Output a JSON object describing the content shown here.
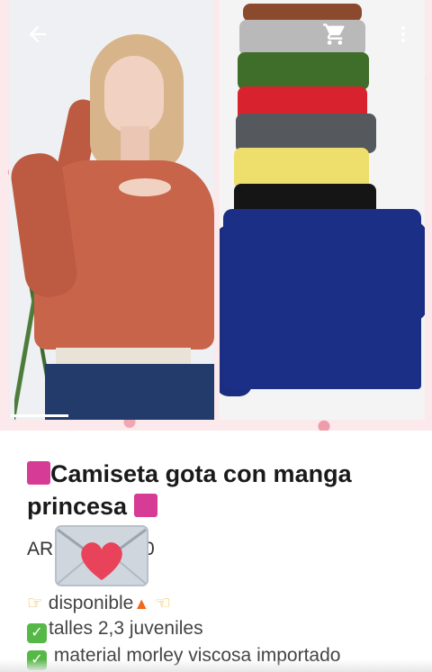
{
  "toolbar": {
    "back_icon": "arrow-left-icon",
    "cart_icon": "shopping-cart-icon",
    "more_icon": "more-vertical-icon"
  },
  "gallery": {
    "progress_fraction": 0.28
  },
  "product": {
    "title_line1": "Camiseta gota con manga",
    "title_line2": "princesa",
    "title_emoji_icon": "purple-square-icon",
    "price_prefix": "AR",
    "price_suffix": "0",
    "overlay_icon": "love-letter-icon"
  },
  "description": {
    "line1": "disponible",
    "line2": "talles 2,3 juveniles",
    "line3": "material morley viscosa importado"
  },
  "colors": {
    "accent_square": "#d63c96",
    "check_green": "#56b947",
    "hero_background": "#fbe9ec"
  }
}
